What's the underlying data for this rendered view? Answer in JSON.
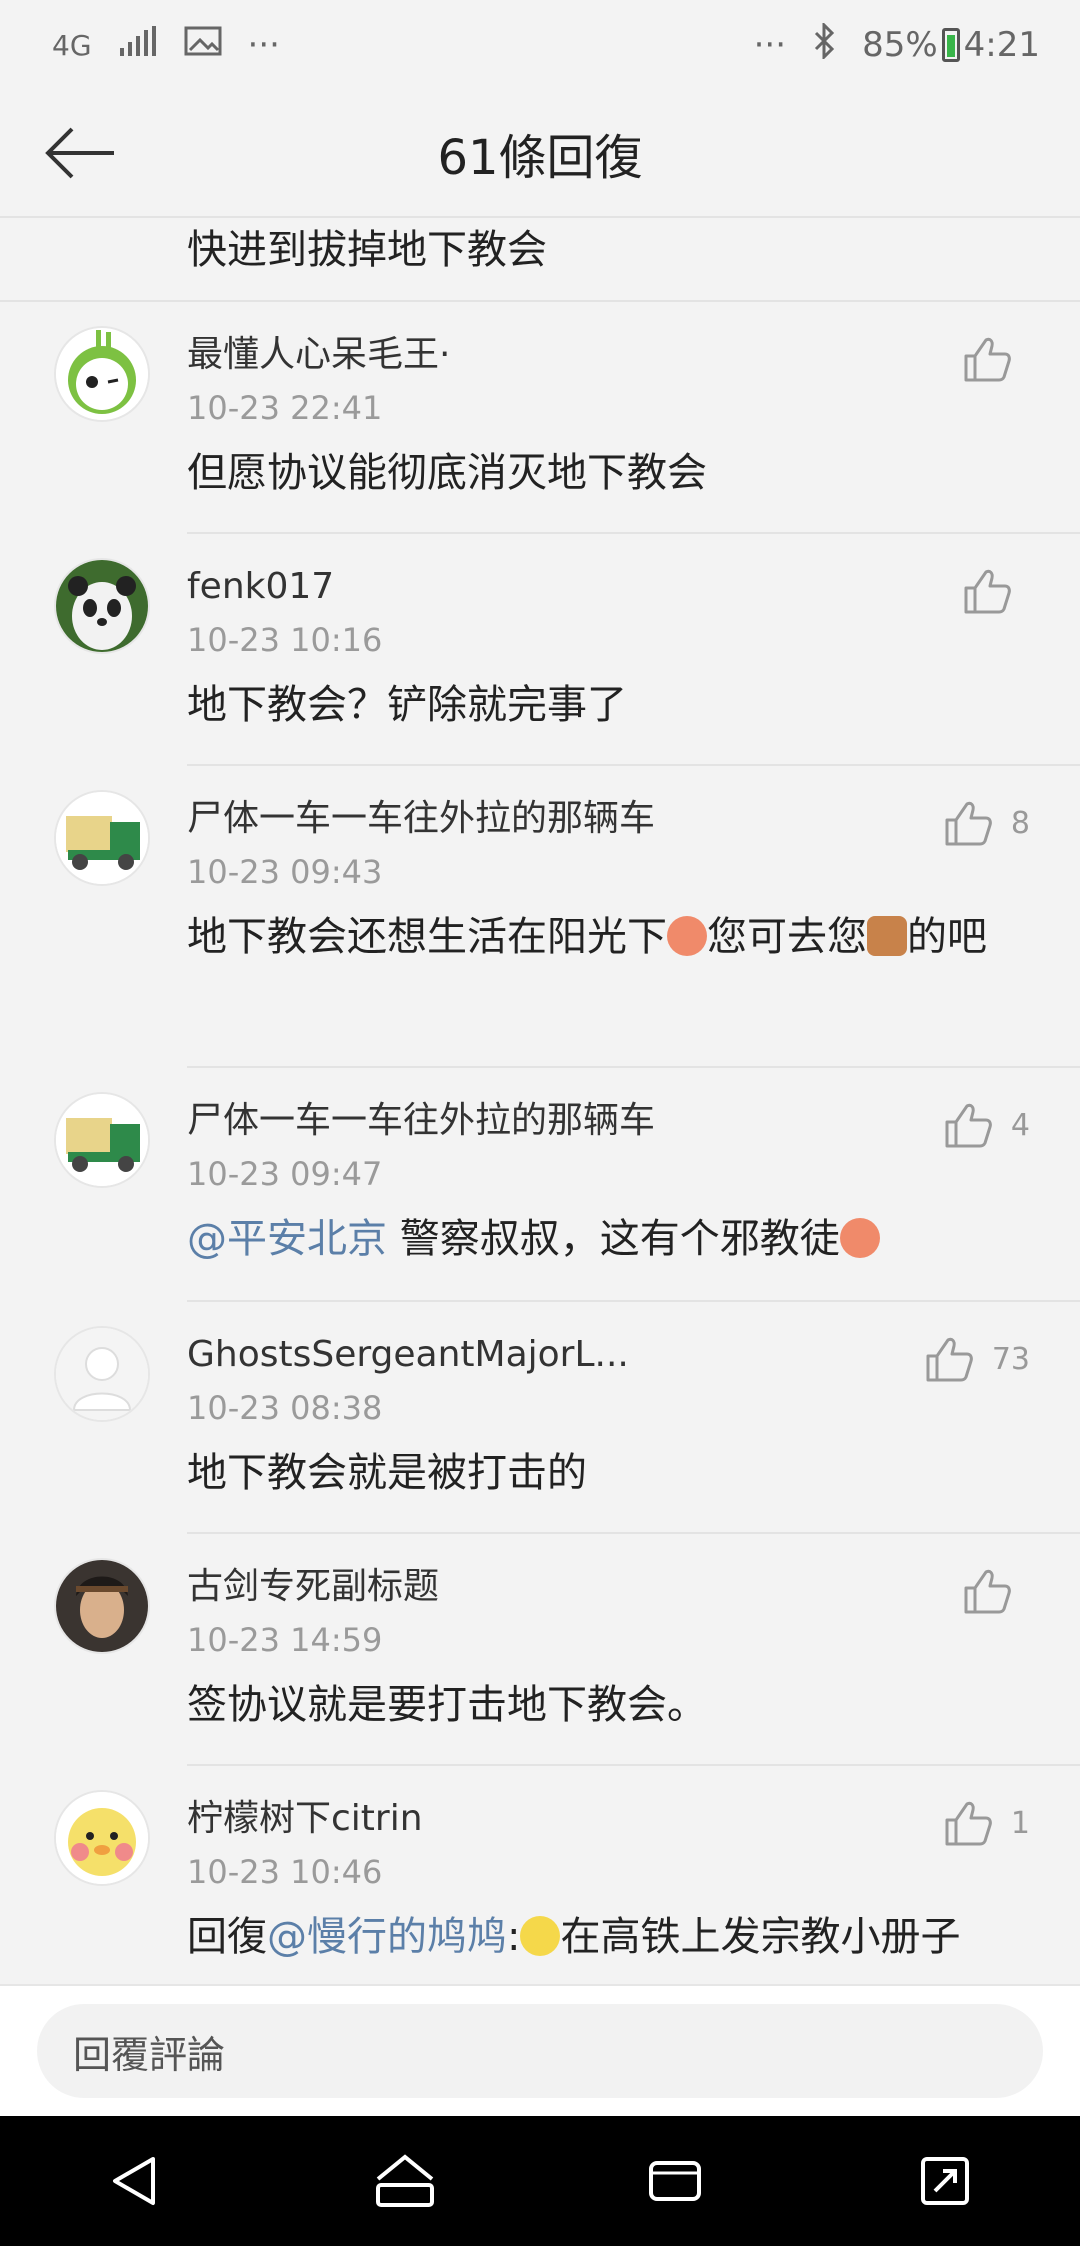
{
  "status_bar": {
    "network": "4G",
    "dots_left": "···",
    "dots_right": "···",
    "battery": "85%",
    "time": "4:21"
  },
  "header": {
    "title": "61條回復"
  },
  "top_snippet": "快进到拔掉地下教会",
  "comments": [
    {
      "username": "最懂人心呆毛王·",
      "time": "10-23 22:41",
      "text": "但愿协议能彻底消灭地下教会",
      "likes": ""
    },
    {
      "username": "fenk017",
      "time": "10-23 10:16",
      "text": "地下教会？铲除就完事了",
      "likes": ""
    },
    {
      "username": "尸体一车一车往外拉的那辆车",
      "time": "10-23 09:43",
      "text_a": "地下教会还想生活在阳光下",
      "text_b": "您可去您",
      "text_c": "的吧",
      "likes": "8"
    },
    {
      "username": "尸体一车一车往外拉的那辆车",
      "time": "10-23 09:47",
      "mention": "@平安北京",
      "text": " 警察叔叔，这有个邪教徒",
      "likes": "4"
    },
    {
      "username": "GhostsSergeantMajorL...",
      "time": "10-23 08:38",
      "text": "地下教会就是被打击的",
      "likes": "73"
    },
    {
      "username": "古剑专死副标题",
      "time": "10-23 14:59",
      "text": "签协议就是要打击地下教会。",
      "likes": ""
    },
    {
      "username": "柠檬树下citrin",
      "time": "10-23 10:46",
      "reply_prefix": "回復",
      "mention": "@慢行的鸠鸠",
      "colon": ":",
      "text": "在高铁上发宗教小册子",
      "likes": "1"
    }
  ],
  "reply_bar": {
    "placeholder": "回覆評論"
  },
  "colors": {
    "mention": "#5b7fa8",
    "background": "#f3f3f3"
  }
}
